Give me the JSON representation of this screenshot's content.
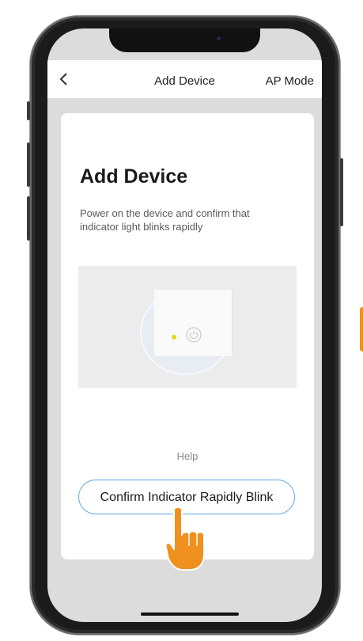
{
  "navbar": {
    "back_icon": "chevron-left-icon",
    "title": "Add Device",
    "mode": "AP Mode"
  },
  "card": {
    "title": "Add Device",
    "description": "Power on the device and confirm that indicator light blinks rapidly",
    "help": "Help",
    "confirm_button": "Confirm Indicator Rapidly Blink"
  },
  "colors": {
    "accent_border": "#5ba6e0",
    "indicator_led": "#e8d320",
    "pointer": "#f0901e"
  },
  "icons": [
    "chevron-left-icon",
    "power-icon",
    "pointing-hand-icon"
  ]
}
